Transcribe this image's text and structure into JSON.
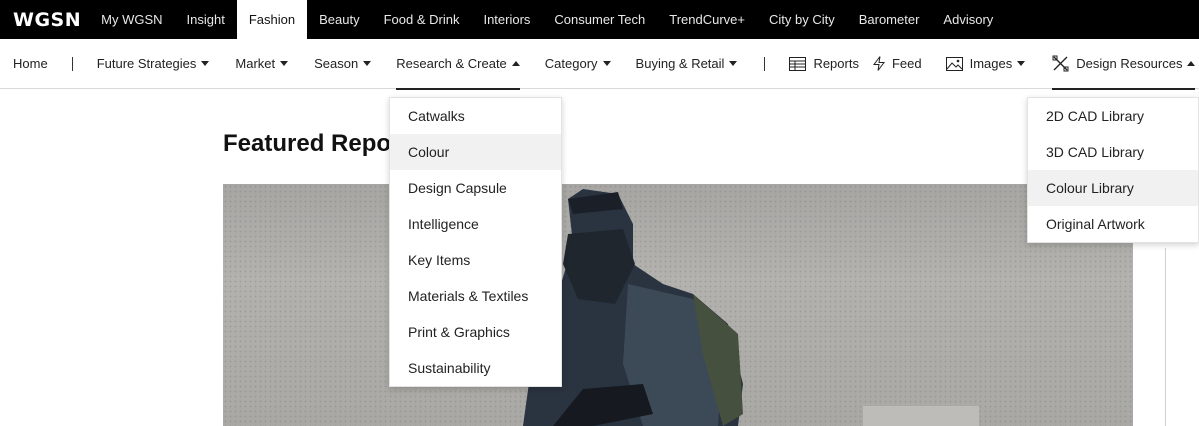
{
  "brand": {
    "logo": "WGSN"
  },
  "top_nav": [
    {
      "label": "My WGSN",
      "active": false
    },
    {
      "label": "Insight",
      "active": false
    },
    {
      "label": "Fashion",
      "active": true
    },
    {
      "label": "Beauty",
      "active": false
    },
    {
      "label": "Food & Drink",
      "active": false
    },
    {
      "label": "Interiors",
      "active": false
    },
    {
      "label": "Consumer Tech",
      "active": false
    },
    {
      "label": "TrendCurve+",
      "active": false
    },
    {
      "label": "City by City",
      "active": false
    },
    {
      "label": "Barometer",
      "active": false
    },
    {
      "label": "Advisory",
      "active": false
    }
  ],
  "sub_nav": {
    "home": "Home",
    "future_strategies": "Future Strategies",
    "market": "Market",
    "season": "Season",
    "research_create": "Research & Create",
    "category": "Category",
    "buying_retail": "Buying & Retail",
    "reports": "Reports",
    "feed": "Feed",
    "images": "Images",
    "design_resources": "Design Resources"
  },
  "research_menu": [
    "Catwalks",
    "Colour",
    "Design Capsule",
    "Intelligence",
    "Key Items",
    "Materials & Textiles",
    "Print & Graphics",
    "Sustainability"
  ],
  "research_highlighted": "Colour",
  "design_menu": [
    "2D CAD Library",
    "3D CAD Library",
    "Colour Library",
    "Original Artwork"
  ],
  "design_highlighted": "Colour Library",
  "main": {
    "heading": "Featured Repo"
  },
  "icons": [
    "reports-icon",
    "feed-icon",
    "images-icon",
    "design-resources-icon"
  ]
}
